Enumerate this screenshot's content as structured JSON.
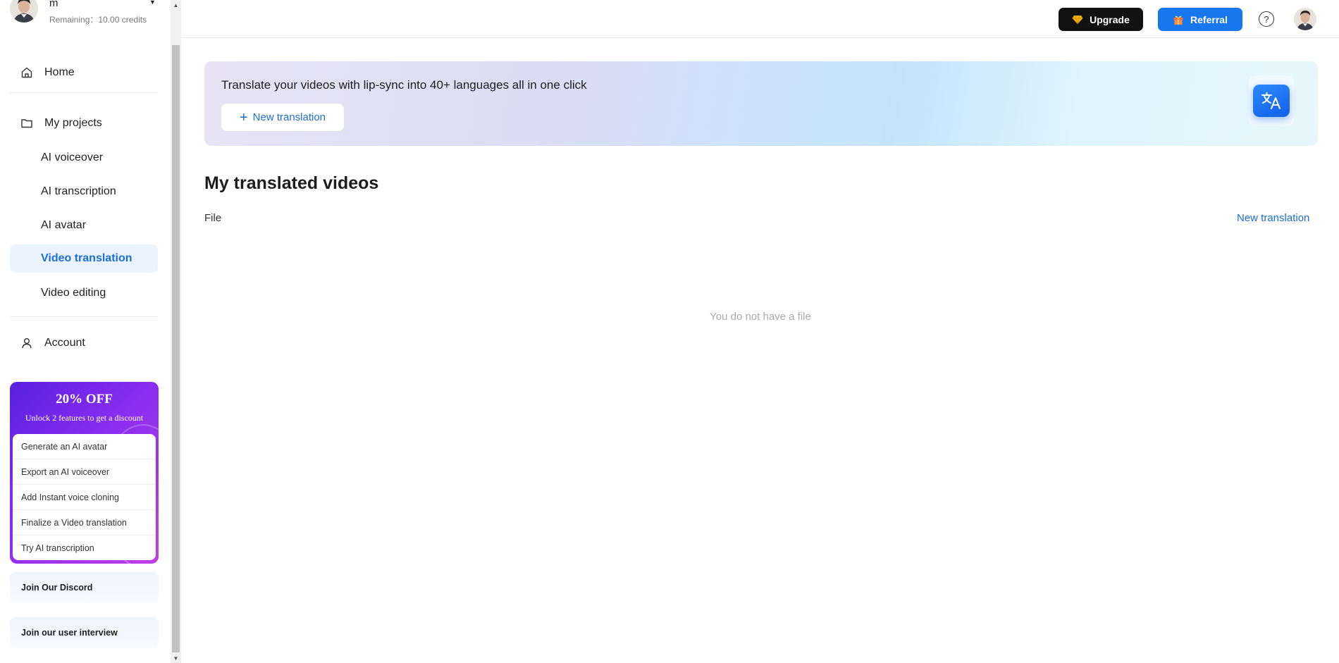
{
  "user": {
    "name": "m",
    "credits": "Remaining：10.00 credits"
  },
  "nav": {
    "home": "Home",
    "my_projects": "My projects",
    "sub_items": [
      "AI voiceover",
      "AI transcription",
      "AI avatar",
      "Video translation",
      "Video editing"
    ],
    "active_item": "Video translation",
    "account": "Account"
  },
  "promo": {
    "title": "20% OFF",
    "subtitle": "Unlock 2 features to get a discount",
    "items": [
      "Generate an AI avatar",
      "Export an AI voiceover",
      "Add Instant voice cloning",
      "Finalize a Video translation",
      "Try AI transcription"
    ]
  },
  "side_cards": {
    "discord": "Join Our Discord",
    "interview": "Join our user interview"
  },
  "header": {
    "upgrade": "Upgrade",
    "referral": "Referral",
    "help": "?"
  },
  "banner": {
    "text": "Translate your videos with lip-sync into 40+ languages all in one click",
    "button": "New translation"
  },
  "main": {
    "title": "My translated videos",
    "column_file": "File",
    "new_link": "New translation",
    "empty": "You do not have a file"
  },
  "colors": {
    "accent": "#1a6fd8",
    "referral_bg": "#1677ee",
    "upgrade_bg": "#111111",
    "active_bg": "#eaf3ff",
    "promo_start": "#5a1fe0",
    "promo_end": "#c23fe6"
  },
  "icons": {
    "home": "home-icon",
    "folder": "folder-icon",
    "account": "user-icon",
    "upgrade": "diamond-icon",
    "referral": "gift-icon",
    "help": "question-icon",
    "banner": "translate-icon"
  }
}
